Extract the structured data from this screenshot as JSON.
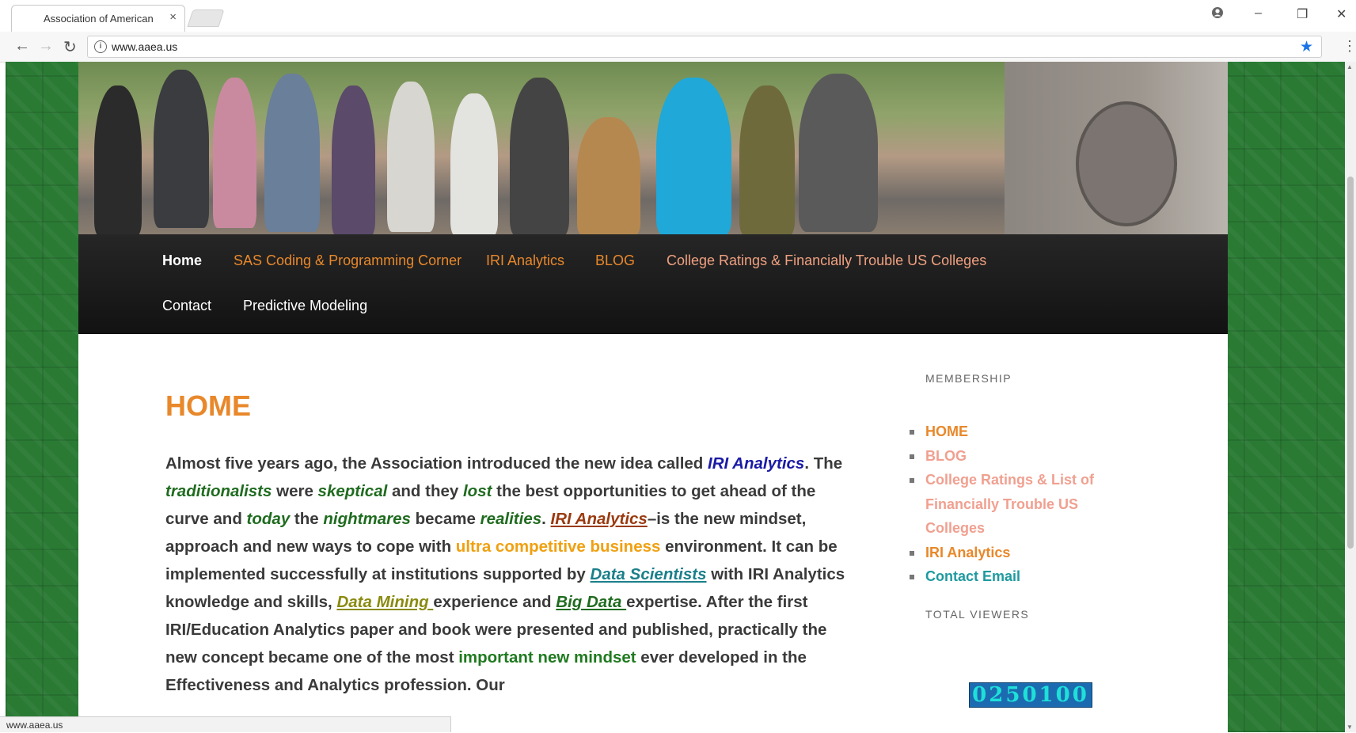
{
  "browser": {
    "tab_title": "Association of American",
    "tab_close": "×",
    "url": "www.aaea.us",
    "status_url": "www.aaea.us"
  },
  "nav": {
    "items": [
      {
        "label": "Home",
        "color": "#ffffff"
      },
      {
        "label": "SAS Coding & Programming Corner",
        "color": "#e8882b"
      },
      {
        "label": "IRI Analytics",
        "color": "#e8882b"
      },
      {
        "label": "BLOG",
        "color": "#e8882b"
      },
      {
        "label": "College Ratings & Financially Trouble US Colleges",
        "color": "#f0a080"
      },
      {
        "label": "Contact",
        "color": "#ffffff"
      },
      {
        "label": "Predictive Modeling",
        "color": "#ffffff"
      }
    ]
  },
  "main": {
    "title": "HOME",
    "paragraph": {
      "t1": "Almost five years ago, the Association introduced the new idea called ",
      "iri1": "IRI Analytics",
      "t2": ". The ",
      "traditionalists": "traditionalists",
      "t3": " were ",
      "skeptical": "skeptical",
      "t4": " and they ",
      "lost": "lost",
      "t5": " the best opportunities to get ahead of the curve and ",
      "today": "today",
      "t6": " the ",
      "nightmares": "nightmares",
      "t7": " became ",
      "realities": "realities",
      "t8": ".  ",
      "iri2": "IRI Analytics",
      "t9": "–is the new mindset, approach and new ways to cope with ",
      "ultra": "ultra competitive business",
      "t10": " environment.  It can be implemented successfully at institutions supported by ",
      "data_scientists": "Data Scientists",
      "t11": " with IRI Analytics knowledge and skills, ",
      "data_mining": "Data Mining ",
      "t12": "experience and ",
      "big_data": "Big Data ",
      "t13": "expertise.  After the first IRI/Education Analytics paper and book were presented and published, practically the new concept became one of the most ",
      "important": "important new mindset",
      "t14": " ever developed in the ",
      "t15": "Effectiveness and Analytics profession.  Our"
    }
  },
  "sidebar": {
    "membership_title": "MEMBERSHIP",
    "links": [
      {
        "label": "HOME",
        "color": "#e8882b"
      },
      {
        "label": "BLOG",
        "color": "#f0a090"
      },
      {
        "label": "College Ratings & List of Financially Trouble US Colleges",
        "color": "#f0a090"
      },
      {
        "label": "IRI Analytics",
        "color": "#e8882b"
      },
      {
        "label": "Contact Email",
        "color": "#1e9aa0"
      }
    ],
    "viewers_title": "TOTAL VIEWERS",
    "viewer_count": "0250100"
  },
  "colors": {
    "accent_orange": "#e8882b",
    "dark_green": "#1f6b1f",
    "blue_link": "#1a1aa6",
    "brown_link": "#9a3a10",
    "teal_link": "#1a7f8a",
    "olive_link": "#8a8a10"
  }
}
